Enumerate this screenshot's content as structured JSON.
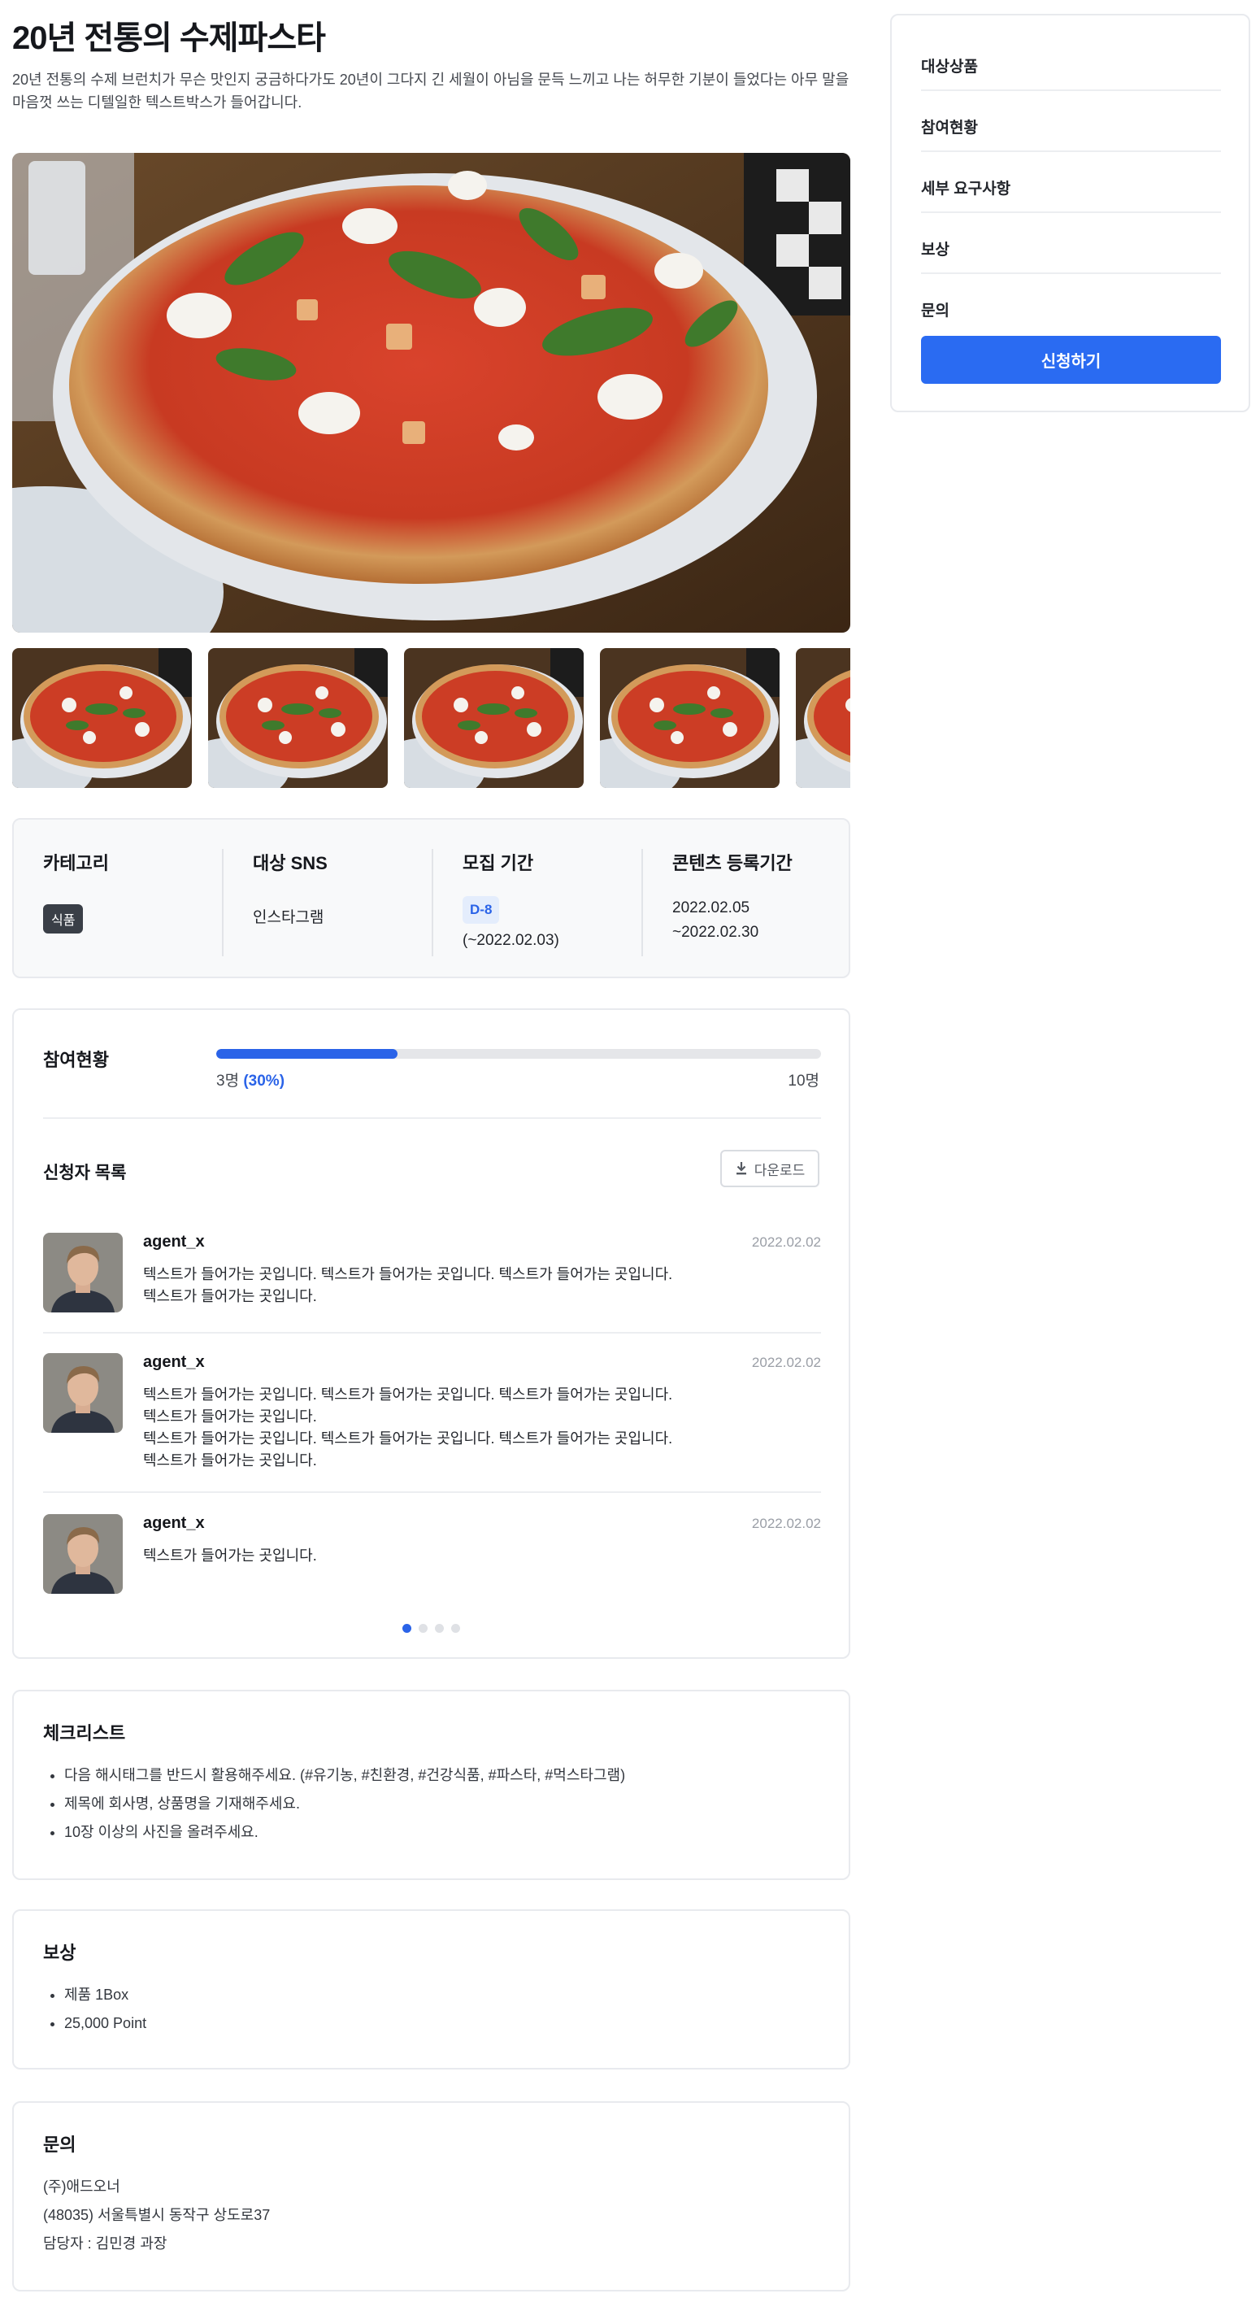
{
  "title": "20년 전통의 수제파스타",
  "description": "20년 전통의 수제 브런치가 무슨 맛인지 궁금하다가도 20년이 그다지 긴 세월이 아님을 문득 느끼고 나는 허무한 기분이 들었다는 아무 말을 마음껏 쓰는 디텔일한 텍스트박스가 들어갑니다.",
  "images": {
    "hero": "pizza-photo",
    "thumbnails": [
      "pizza-photo",
      "pizza-photo",
      "pizza-photo",
      "pizza-photo",
      "pizza-photo"
    ]
  },
  "info": {
    "category_label": "카테고리",
    "category_value": "식품",
    "sns_label": "대상 SNS",
    "sns_value": "인스타그램",
    "recruit_label": "모집 기간",
    "recruit_badge": "D-8",
    "recruit_until": "(~2022.02.03)",
    "content_label": "콘텐츠 등록기간",
    "content_start": "2022.02.05",
    "content_end": "~2022.02.30"
  },
  "participation": {
    "title": "참여현황",
    "current": "3명",
    "percent_text": "(30%)",
    "percent": 30,
    "total": "10명",
    "applicants_title": "신청자 목록",
    "download_label": "다운로드",
    "applicants": [
      {
        "name": "agent_x",
        "date": "2022.02.02",
        "lines": [
          "텍스트가 들어가는 곳입니다. 텍스트가 들어가는 곳입니다. 텍스트가 들어가는 곳입니다.",
          "텍스트가 들어가는 곳입니다."
        ]
      },
      {
        "name": "agent_x",
        "date": "2022.02.02",
        "lines": [
          "텍스트가 들어가는 곳입니다. 텍스트가 들어가는 곳입니다. 텍스트가 들어가는 곳입니다.",
          "텍스트가 들어가는 곳입니다.",
          "텍스트가 들어가는 곳입니다. 텍스트가 들어가는 곳입니다. 텍스트가 들어가는 곳입니다.",
          "텍스트가 들어가는 곳입니다."
        ]
      },
      {
        "name": "agent_x",
        "date": "2022.02.02",
        "lines": [
          "텍스트가 들어가는 곳입니다."
        ]
      }
    ],
    "pagination": {
      "pages": 4,
      "current": 1
    }
  },
  "checklist": {
    "title": "체크리스트",
    "items": [
      "다음 해시태그를 반드시 활용해주세요. (#유기농, #친환경, #건강식품, #파스타, #먹스타그램)",
      "제목에 회사명, 상품명을 기재해주세요.",
      "10장 이상의 사진을 올려주세요."
    ]
  },
  "reward": {
    "title": "보상",
    "items": [
      "제품 1Box",
      "25,000 Point"
    ]
  },
  "contact": {
    "title": "문의",
    "company": "(주)애드오너",
    "address": "(48035) 서울특별시 동작구 상도로37",
    "manager": "담당자 : 김민경 과장"
  },
  "sidebar": {
    "items": [
      "대상상품",
      "참여현황",
      "세부 요구사항",
      "보상",
      "문의"
    ],
    "apply_label": "신청하기"
  },
  "colors": {
    "accent": "#2a63e8",
    "button": "#2a6bf2",
    "border": "#e8eaee",
    "category_badge": "#3a3f47"
  }
}
